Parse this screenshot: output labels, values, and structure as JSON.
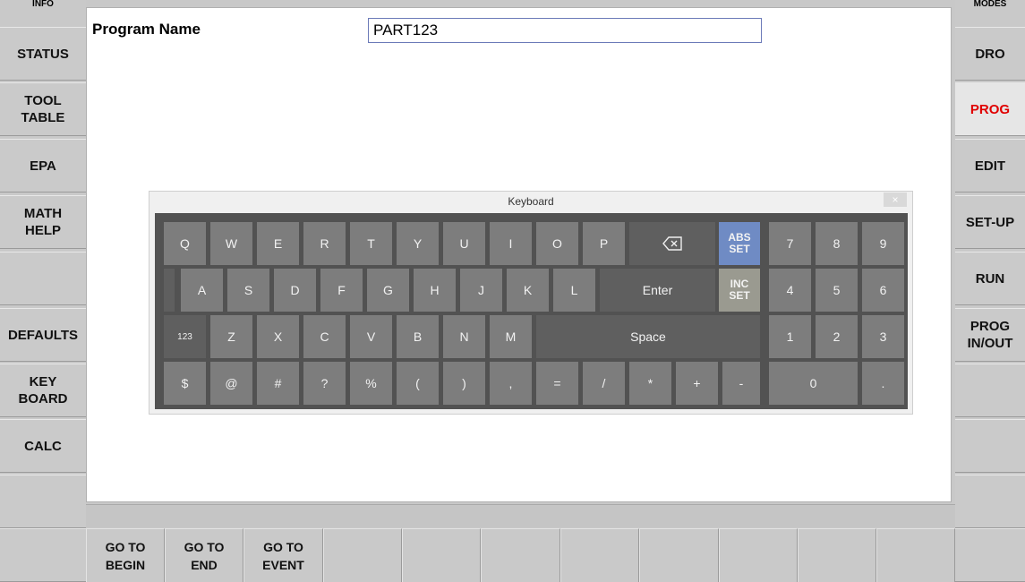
{
  "left_panel": {
    "header": "INFO",
    "buttons": [
      "STATUS",
      "TOOL\nTABLE",
      "EPA",
      "MATH\nHELP",
      "",
      "DEFAULTS",
      "KEY\nBOARD",
      "CALC",
      "",
      ""
    ]
  },
  "right_panel": {
    "header": "MODES",
    "buttons": [
      "DRO",
      "PROG",
      "EDIT",
      "SET-UP",
      "RUN",
      "PROG\nIN/OUT",
      "",
      "",
      "",
      ""
    ],
    "active_index": 1,
    "active_color": "#e00000"
  },
  "main": {
    "program_label": "Program Name",
    "program_value": "PART123"
  },
  "bottom_keys": [
    "GO TO\nBEGIN",
    "GO TO\nEND",
    "GO TO\nEVENT",
    "",
    "",
    "",
    "",
    "",
    "",
    "",
    ""
  ],
  "keyboard": {
    "title": "Keyboard",
    "close": "×",
    "row1": [
      "Q",
      "W",
      "E",
      "R",
      "T",
      "Y",
      "U",
      "I",
      "O",
      "P"
    ],
    "backspace_icon": "backspace-icon",
    "abs_set": "ABS\nSET",
    "row2": [
      "A",
      "S",
      "D",
      "F",
      "G",
      "H",
      "J",
      "K",
      "L"
    ],
    "enter": "Enter",
    "inc_set": "INC\nSET",
    "mode_123": "123",
    "row3": [
      "Z",
      "X",
      "C",
      "V",
      "B",
      "N",
      "M"
    ],
    "space": "Space",
    "row4": [
      "$",
      "@",
      "#",
      "?",
      "%",
      "(",
      ")",
      ",",
      "=",
      "/",
      "*",
      "+",
      "-"
    ],
    "numpad": [
      "7",
      "8",
      "9",
      "4",
      "5",
      "6",
      "1",
      "2",
      "3"
    ],
    "zero": "0",
    "dot": ".",
    "colors": {
      "abs_set": "#6f8bc4",
      "inc_set": "#9a9a90",
      "key": "#7d7d7d",
      "panel": "#525252"
    }
  }
}
